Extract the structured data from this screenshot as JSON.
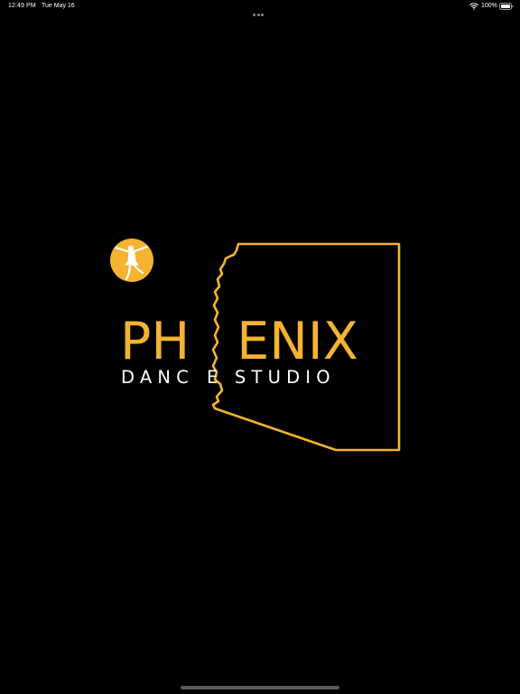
{
  "status_bar": {
    "time": "12:49 PM",
    "date": "Tue May 16",
    "battery_percent": "100%",
    "icons": [
      "more-dots-icon",
      "wifi-icon",
      "battery-icon"
    ]
  },
  "logo": {
    "word_left": "PH",
    "word_right": "ENIX",
    "tagline_left": "DANC",
    "tagline_right": "E STUDIO",
    "icons": [
      "arizona-outline-icon",
      "dancer-icon"
    ],
    "colors": {
      "brand_gold": "#f4b331",
      "tagline": "#ffffff",
      "background": "#000000"
    }
  }
}
